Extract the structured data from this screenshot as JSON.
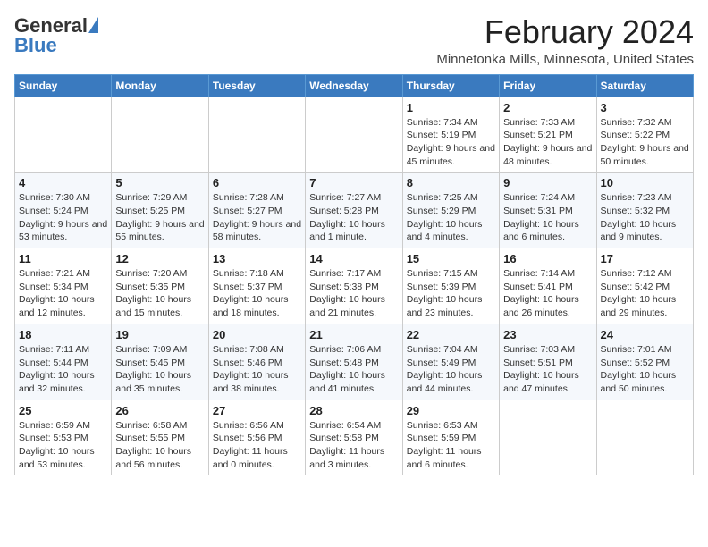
{
  "header": {
    "logo_general": "General",
    "logo_blue": "Blue",
    "month_title": "February 2024",
    "location": "Minnetonka Mills, Minnesota, United States"
  },
  "days_of_week": [
    "Sunday",
    "Monday",
    "Tuesday",
    "Wednesday",
    "Thursday",
    "Friday",
    "Saturday"
  ],
  "weeks": [
    [
      {
        "day": "",
        "sunrise": "",
        "sunset": "",
        "daylight": ""
      },
      {
        "day": "",
        "sunrise": "",
        "sunset": "",
        "daylight": ""
      },
      {
        "day": "",
        "sunrise": "",
        "sunset": "",
        "daylight": ""
      },
      {
        "day": "",
        "sunrise": "",
        "sunset": "",
        "daylight": ""
      },
      {
        "day": "1",
        "sunrise": "Sunrise: 7:34 AM",
        "sunset": "Sunset: 5:19 PM",
        "daylight": "Daylight: 9 hours and 45 minutes."
      },
      {
        "day": "2",
        "sunrise": "Sunrise: 7:33 AM",
        "sunset": "Sunset: 5:21 PM",
        "daylight": "Daylight: 9 hours and 48 minutes."
      },
      {
        "day": "3",
        "sunrise": "Sunrise: 7:32 AM",
        "sunset": "Sunset: 5:22 PM",
        "daylight": "Daylight: 9 hours and 50 minutes."
      }
    ],
    [
      {
        "day": "4",
        "sunrise": "Sunrise: 7:30 AM",
        "sunset": "Sunset: 5:24 PM",
        "daylight": "Daylight: 9 hours and 53 minutes."
      },
      {
        "day": "5",
        "sunrise": "Sunrise: 7:29 AM",
        "sunset": "Sunset: 5:25 PM",
        "daylight": "Daylight: 9 hours and 55 minutes."
      },
      {
        "day": "6",
        "sunrise": "Sunrise: 7:28 AM",
        "sunset": "Sunset: 5:27 PM",
        "daylight": "Daylight: 9 hours and 58 minutes."
      },
      {
        "day": "7",
        "sunrise": "Sunrise: 7:27 AM",
        "sunset": "Sunset: 5:28 PM",
        "daylight": "Daylight: 10 hours and 1 minute."
      },
      {
        "day": "8",
        "sunrise": "Sunrise: 7:25 AM",
        "sunset": "Sunset: 5:29 PM",
        "daylight": "Daylight: 10 hours and 4 minutes."
      },
      {
        "day": "9",
        "sunrise": "Sunrise: 7:24 AM",
        "sunset": "Sunset: 5:31 PM",
        "daylight": "Daylight: 10 hours and 6 minutes."
      },
      {
        "day": "10",
        "sunrise": "Sunrise: 7:23 AM",
        "sunset": "Sunset: 5:32 PM",
        "daylight": "Daylight: 10 hours and 9 minutes."
      }
    ],
    [
      {
        "day": "11",
        "sunrise": "Sunrise: 7:21 AM",
        "sunset": "Sunset: 5:34 PM",
        "daylight": "Daylight: 10 hours and 12 minutes."
      },
      {
        "day": "12",
        "sunrise": "Sunrise: 7:20 AM",
        "sunset": "Sunset: 5:35 PM",
        "daylight": "Daylight: 10 hours and 15 minutes."
      },
      {
        "day": "13",
        "sunrise": "Sunrise: 7:18 AM",
        "sunset": "Sunset: 5:37 PM",
        "daylight": "Daylight: 10 hours and 18 minutes."
      },
      {
        "day": "14",
        "sunrise": "Sunrise: 7:17 AM",
        "sunset": "Sunset: 5:38 PM",
        "daylight": "Daylight: 10 hours and 21 minutes."
      },
      {
        "day": "15",
        "sunrise": "Sunrise: 7:15 AM",
        "sunset": "Sunset: 5:39 PM",
        "daylight": "Daylight: 10 hours and 23 minutes."
      },
      {
        "day": "16",
        "sunrise": "Sunrise: 7:14 AM",
        "sunset": "Sunset: 5:41 PM",
        "daylight": "Daylight: 10 hours and 26 minutes."
      },
      {
        "day": "17",
        "sunrise": "Sunrise: 7:12 AM",
        "sunset": "Sunset: 5:42 PM",
        "daylight": "Daylight: 10 hours and 29 minutes."
      }
    ],
    [
      {
        "day": "18",
        "sunrise": "Sunrise: 7:11 AM",
        "sunset": "Sunset: 5:44 PM",
        "daylight": "Daylight: 10 hours and 32 minutes."
      },
      {
        "day": "19",
        "sunrise": "Sunrise: 7:09 AM",
        "sunset": "Sunset: 5:45 PM",
        "daylight": "Daylight: 10 hours and 35 minutes."
      },
      {
        "day": "20",
        "sunrise": "Sunrise: 7:08 AM",
        "sunset": "Sunset: 5:46 PM",
        "daylight": "Daylight: 10 hours and 38 minutes."
      },
      {
        "day": "21",
        "sunrise": "Sunrise: 7:06 AM",
        "sunset": "Sunset: 5:48 PM",
        "daylight": "Daylight: 10 hours and 41 minutes."
      },
      {
        "day": "22",
        "sunrise": "Sunrise: 7:04 AM",
        "sunset": "Sunset: 5:49 PM",
        "daylight": "Daylight: 10 hours and 44 minutes."
      },
      {
        "day": "23",
        "sunrise": "Sunrise: 7:03 AM",
        "sunset": "Sunset: 5:51 PM",
        "daylight": "Daylight: 10 hours and 47 minutes."
      },
      {
        "day": "24",
        "sunrise": "Sunrise: 7:01 AM",
        "sunset": "Sunset: 5:52 PM",
        "daylight": "Daylight: 10 hours and 50 minutes."
      }
    ],
    [
      {
        "day": "25",
        "sunrise": "Sunrise: 6:59 AM",
        "sunset": "Sunset: 5:53 PM",
        "daylight": "Daylight: 10 hours and 53 minutes."
      },
      {
        "day": "26",
        "sunrise": "Sunrise: 6:58 AM",
        "sunset": "Sunset: 5:55 PM",
        "daylight": "Daylight: 10 hours and 56 minutes."
      },
      {
        "day": "27",
        "sunrise": "Sunrise: 6:56 AM",
        "sunset": "Sunset: 5:56 PM",
        "daylight": "Daylight: 11 hours and 0 minutes."
      },
      {
        "day": "28",
        "sunrise": "Sunrise: 6:54 AM",
        "sunset": "Sunset: 5:58 PM",
        "daylight": "Daylight: 11 hours and 3 minutes."
      },
      {
        "day": "29",
        "sunrise": "Sunrise: 6:53 AM",
        "sunset": "Sunset: 5:59 PM",
        "daylight": "Daylight: 11 hours and 6 minutes."
      },
      {
        "day": "",
        "sunrise": "",
        "sunset": "",
        "daylight": ""
      },
      {
        "day": "",
        "sunrise": "",
        "sunset": "",
        "daylight": ""
      }
    ]
  ]
}
